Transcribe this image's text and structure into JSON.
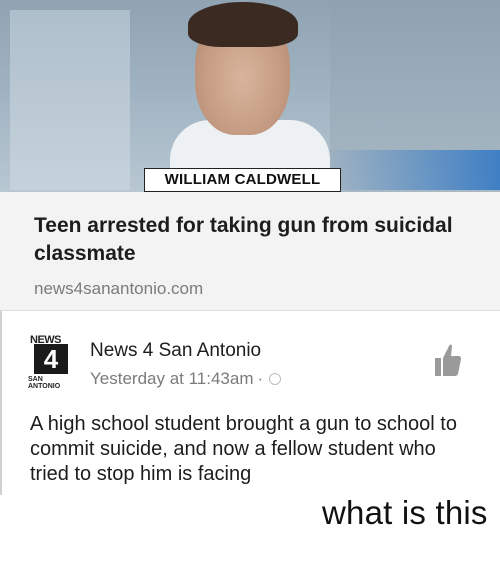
{
  "photo": {
    "caption": "WILLIAM CALDWELL"
  },
  "link_preview": {
    "headline": "Teen arrested for taking gun from suicidal classmate",
    "domain": "news4sanantonio.com"
  },
  "post": {
    "logo": {
      "top_text": "NEWS",
      "number": "4",
      "bottom_text": "SAN ANTONIO"
    },
    "page_name": "News 4 San Antonio",
    "timestamp": "Yesterday at 11:43am",
    "separator": "·",
    "privacy_icon": "globe-icon",
    "like_icon": "thumbs-up-icon",
    "body": "A high school student brought a gun to school to commit suicide, and now a fellow student who tried to stop him is facing"
  },
  "meme_caption": "what is this",
  "colors": {
    "link_card_bg": "#f3f3f4",
    "meta_gray": "#7b7b7b",
    "text": "#1d1d1d"
  }
}
